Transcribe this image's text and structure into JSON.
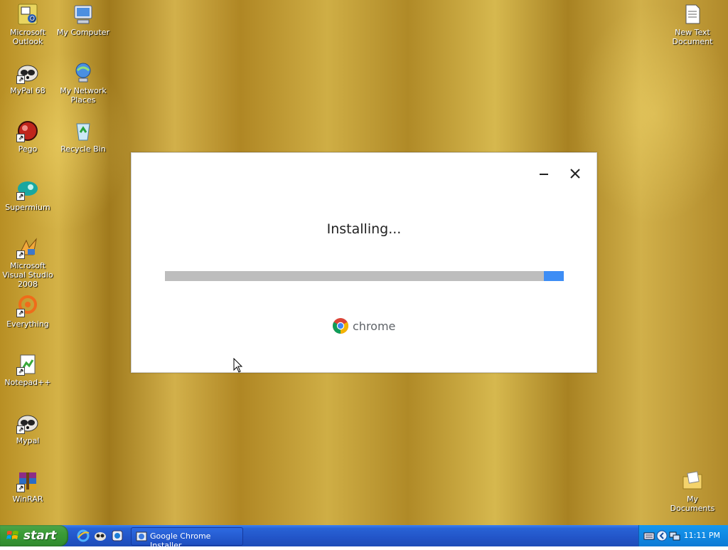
{
  "desktop": {
    "icons": [
      {
        "label": "Microsoft Outlook",
        "icon": "outlook-icon"
      },
      {
        "label": "My Computer",
        "icon": "my-computer-icon"
      },
      {
        "label": "MyPal 68",
        "icon": "mypal-icon"
      },
      {
        "label": "My Network Places",
        "icon": "network-places-icon"
      },
      {
        "label": "Pego",
        "icon": "pego-icon"
      },
      {
        "label": "Recycle Bin",
        "icon": "recycle-bin-icon"
      },
      {
        "label": "Supermium",
        "icon": "supermium-icon"
      },
      {
        "label": "Microsoft Visual Studio 2008",
        "icon": "visual-studio-icon"
      },
      {
        "label": "Everything",
        "icon": "everything-icon"
      },
      {
        "label": "Notepad++",
        "icon": "notepad-plus-plus-icon"
      },
      {
        "label": "Mypal",
        "icon": "mypal-icon"
      },
      {
        "label": "WinRAR",
        "icon": "winrar-icon"
      },
      {
        "label": "New Text Document",
        "icon": "text-document-icon"
      },
      {
        "label": "My Documents",
        "icon": "my-documents-icon"
      }
    ]
  },
  "installer": {
    "status_text": "Installing...",
    "progress_fraction": 0.05,
    "brand": "chrome",
    "colors": {
      "progress_fill": "#3d8df5",
      "progress_track": "#bdbdbd"
    }
  },
  "taskbar": {
    "start_label": "start",
    "quick_launch": [
      "internet-explorer-icon",
      "mypal-icon",
      "supermium-icon"
    ],
    "tasks": [
      {
        "label": "Google Chrome Installer",
        "icon": "chrome-installer-icon"
      }
    ],
    "tray_icons": [
      "keyboard-icon",
      "collapse-arrow-icon",
      "network-icon"
    ],
    "clock": "11:11 PM",
    "colors": {
      "taskbar": "#2254c7",
      "start": "#3a9b36",
      "tray": "#0f8ae0"
    }
  }
}
